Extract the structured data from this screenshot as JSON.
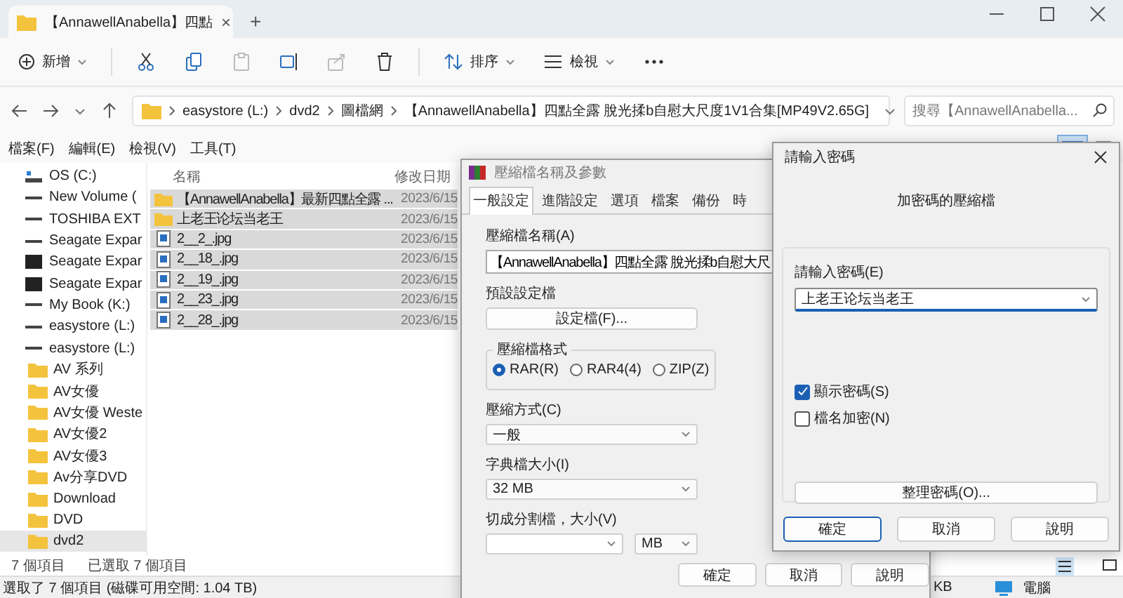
{
  "window": {
    "tab_title": "【AnnawellAnabella】四點",
    "tab_close": "×",
    "new_tab": "+"
  },
  "toolbar": {
    "new": "新增",
    "sort": "排序",
    "view": "檢視"
  },
  "address": {
    "crumbs": [
      "easystore (L:)",
      "dvd2",
      "圖檔網",
      "【AnnawellAnabella】四點全露 脫光揉b自慰大尺度1V1合集[MP49V2.65G]"
    ],
    "search_placeholder": "搜尋【AnnawellAnabella..."
  },
  "menu": [
    "檔案(F)",
    "編輯(E)",
    "檢視(V)",
    "工具(T)"
  ],
  "sidebar": {
    "items": [
      {
        "label": "OS (C:)",
        "kind": "windows-drive",
        "selected": false
      },
      {
        "label": "New Volume (",
        "kind": "drive",
        "selected": false
      },
      {
        "label": "TOSHIBA EXT",
        "kind": "drive",
        "selected": false
      },
      {
        "label": "Seagate Expar",
        "kind": "drive",
        "selected": false
      },
      {
        "label": "Seagate Expar",
        "kind": "external-drive",
        "selected": false
      },
      {
        "label": "Seagate Expar",
        "kind": "external-drive",
        "selected": false
      },
      {
        "label": "My Book (K:)",
        "kind": "drive",
        "selected": false
      },
      {
        "label": "easystore (L:)",
        "kind": "drive",
        "selected": false
      },
      {
        "label": "easystore (L:)",
        "kind": "drive",
        "selected": false,
        "children": [
          {
            "label": "AV 系列",
            "kind": "folder",
            "selected": false
          },
          {
            "label": "AV女優",
            "kind": "folder",
            "selected": false
          },
          {
            "label": "AV女優 Weste",
            "kind": "folder",
            "selected": false
          },
          {
            "label": "AV女優2",
            "kind": "folder",
            "selected": false
          },
          {
            "label": "AV女優3",
            "kind": "folder",
            "selected": false
          },
          {
            "label": "Av分享DVD",
            "kind": "folder",
            "selected": false
          },
          {
            "label": "Download",
            "kind": "folder",
            "selected": false
          },
          {
            "label": "DVD",
            "kind": "folder",
            "selected": false
          },
          {
            "label": "dvd2",
            "kind": "folder",
            "selected": true
          }
        ]
      }
    ]
  },
  "file_list": {
    "columns": [
      "名稱",
      "修改日期"
    ],
    "rows": [
      {
        "name": "【AnnawellAnabella】最新四點全露 ...",
        "date": "2023/6/15",
        "kind": "folder",
        "selected": true
      },
      {
        "name": "上老王论坛当老王",
        "date": "2023/6/15",
        "kind": "folder",
        "selected": true
      },
      {
        "name": "2__2_.jpg",
        "date": "2023/6/15",
        "kind": "image",
        "selected": true
      },
      {
        "name": "2__18_.jpg",
        "date": "2023/6/15",
        "kind": "image",
        "selected": true
      },
      {
        "name": "2__19_.jpg",
        "date": "2023/6/15",
        "kind": "image",
        "selected": true
      },
      {
        "name": "2__23_.jpg",
        "date": "2023/6/15",
        "kind": "image",
        "selected": true
      },
      {
        "name": "2__28_.jpg",
        "date": "2023/6/15",
        "kind": "image",
        "selected": true
      }
    ]
  },
  "footer": {
    "count": "7 個項目",
    "selected_count": "已選取 7 個項目"
  },
  "status_bar": {
    "text": "選取了 7 個項目 (磁碟可用空間: 1.04 TB)",
    "size": "KB",
    "location": "電腦"
  },
  "archive_dialog": {
    "title": "壓縮檔名稱及參數",
    "tabs": [
      {
        "label": "一般設定",
        "selected": true
      },
      {
        "label": "進階設定",
        "selected": false
      },
      {
        "label": "選項",
        "selected": false
      },
      {
        "label": "檔案",
        "selected": false
      },
      {
        "label": "備份",
        "selected": false
      },
      {
        "label": "時",
        "selected": false
      }
    ],
    "name_label": "壓縮檔名稱(A)",
    "name_value": "【AnnawellAnabella】四點全露 脫光揉b自慰大尺",
    "profile_label": "預設設定檔",
    "profile_button": "設定檔(F)...",
    "format_label": "壓縮檔格式",
    "formats": [
      {
        "label": "RAR(R)",
        "selected": true
      },
      {
        "label": "RAR4(4)",
        "selected": false
      },
      {
        "label": "ZIP(Z)",
        "selected": false
      }
    ],
    "method_label": "壓縮方式(C)",
    "method_value": "一般",
    "dict_label": "字典檔大小(I)",
    "dict_value": "32 MB",
    "split_label": "切成分割檔，大小(V)",
    "split_unit": "MB",
    "buttons": [
      "確定",
      "取消",
      "說明"
    ]
  },
  "password_dialog": {
    "title": "請輸入密碼",
    "subtitle": "加密碼的壓縮檔",
    "field_label": "請輸入密碼(E)",
    "value": "上老王论坛当老王",
    "checkboxes": [
      {
        "label": "顯示密碼(S)",
        "checked": true
      },
      {
        "label": "檔名加密(N)",
        "checked": false
      }
    ],
    "organize_button": "整理密碼(O)...",
    "buttons": [
      {
        "label": "確定",
        "default": true
      },
      {
        "label": "取消",
        "default": false
      },
      {
        "label": "說明",
        "default": false
      }
    ]
  }
}
